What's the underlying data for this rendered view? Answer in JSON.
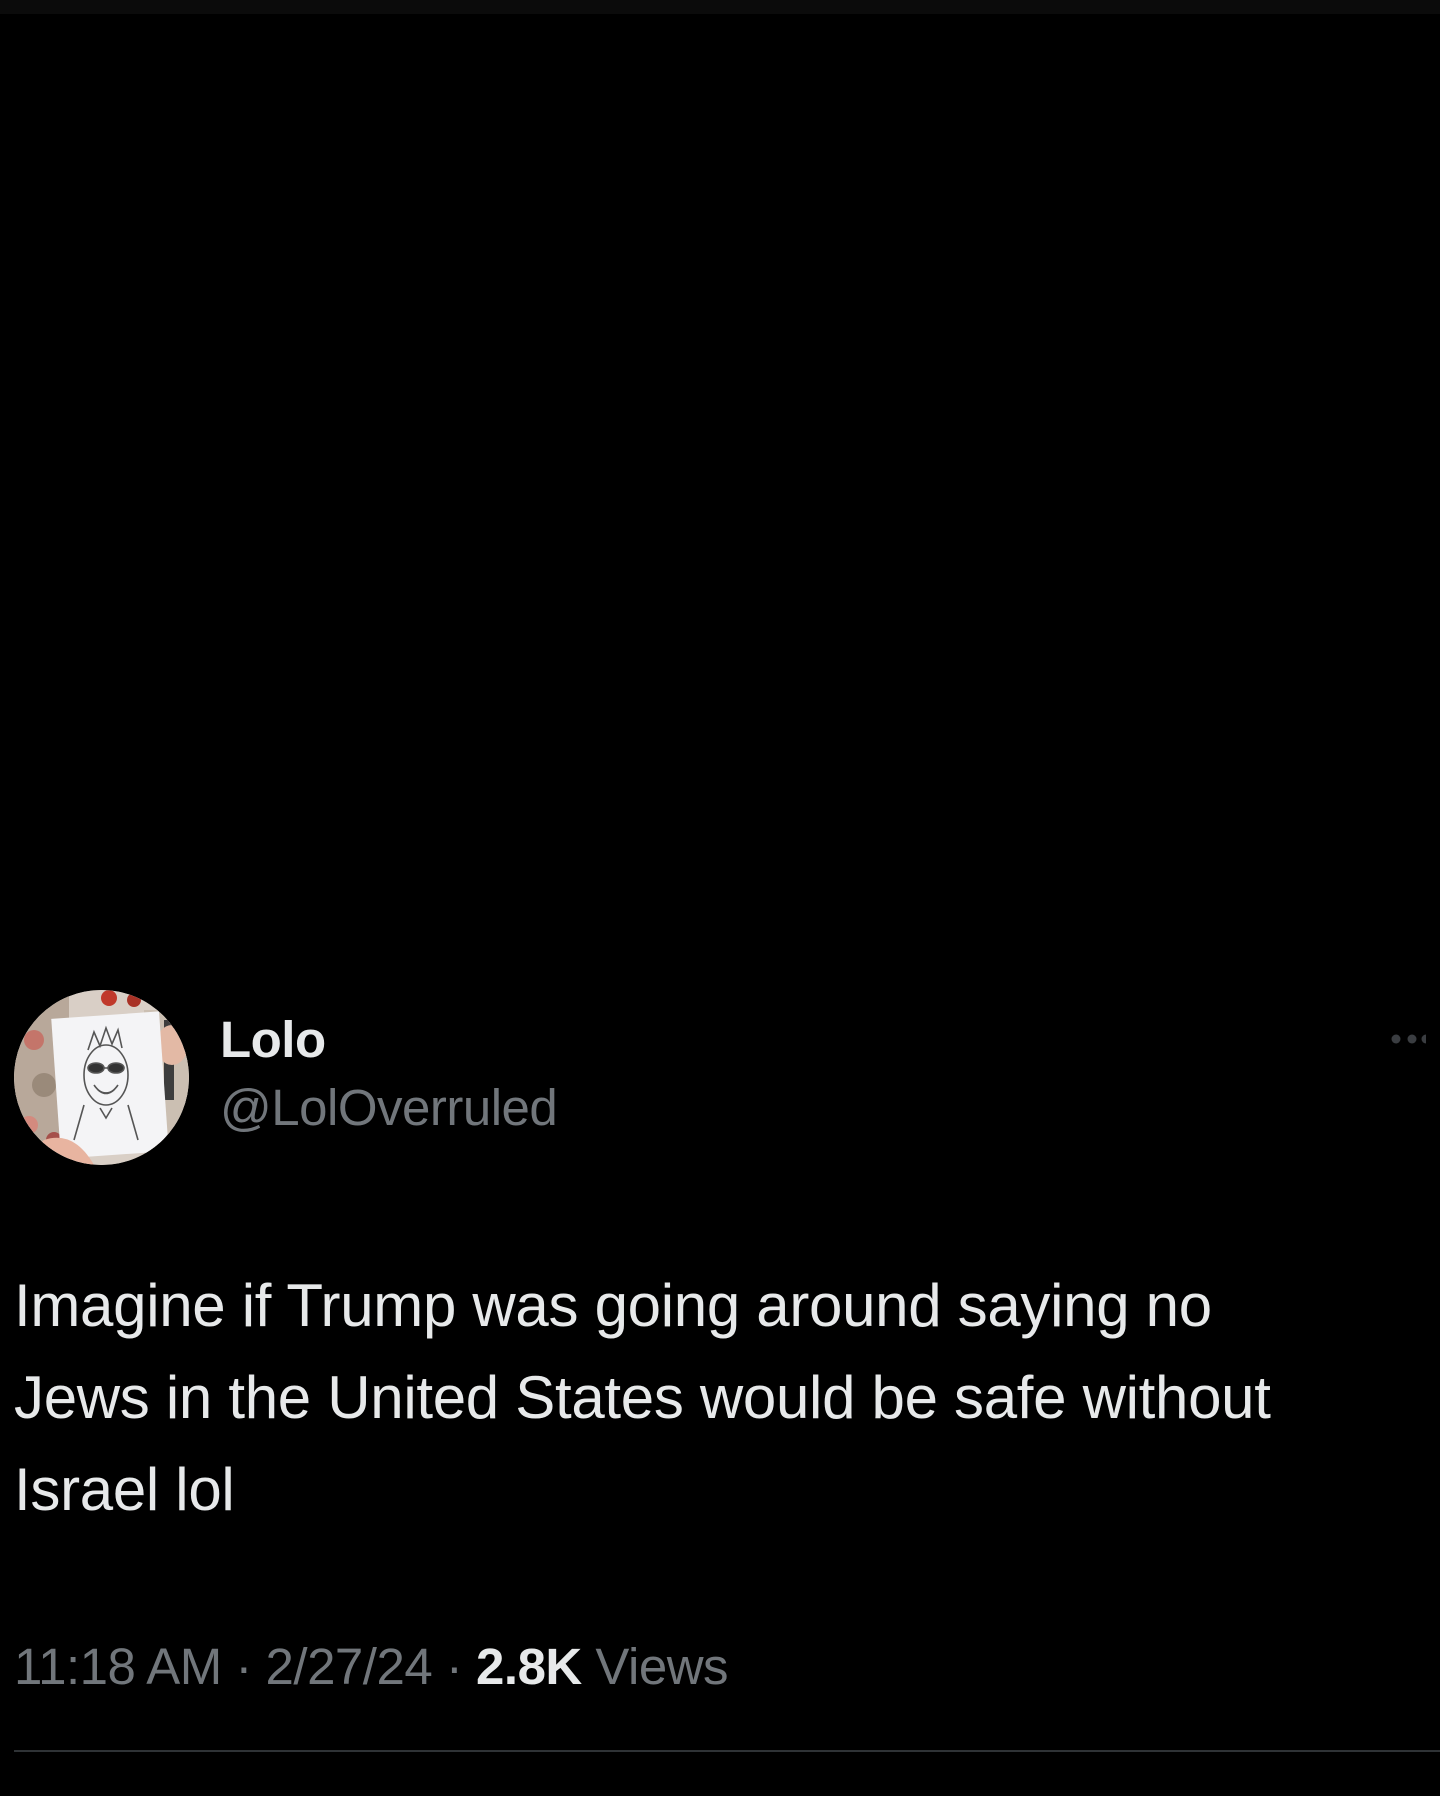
{
  "tweet": {
    "author": {
      "display_name": "Lolo",
      "handle": "@LolOverruled"
    },
    "text": "Imagine if Trump was going around saying no\nJews in the United States would be safe without\nIsrael lol",
    "meta": {
      "time": "11:18 AM",
      "separator": " · ",
      "date": "2/27/24",
      "views_count": "2.8K",
      "views_label": " Views"
    }
  },
  "icons": {
    "more": "more-horizontal-icon",
    "avatar": "avatar-drawing-portrait"
  },
  "colors": {
    "background": "#000000",
    "primary_text": "#e7e9ea",
    "secondary_text": "#71767b",
    "divider": "#2f3336"
  }
}
